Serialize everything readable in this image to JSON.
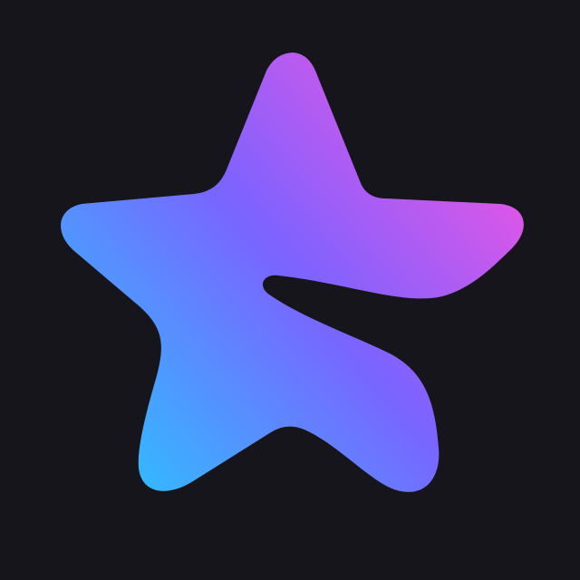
{
  "app_icon": {
    "name": "gradient-star-icon",
    "background_color": "#17151c",
    "gradient": {
      "start_color": "#35b7ff",
      "mid_color": "#7b63ff",
      "end_color": "#e455e6"
    }
  }
}
